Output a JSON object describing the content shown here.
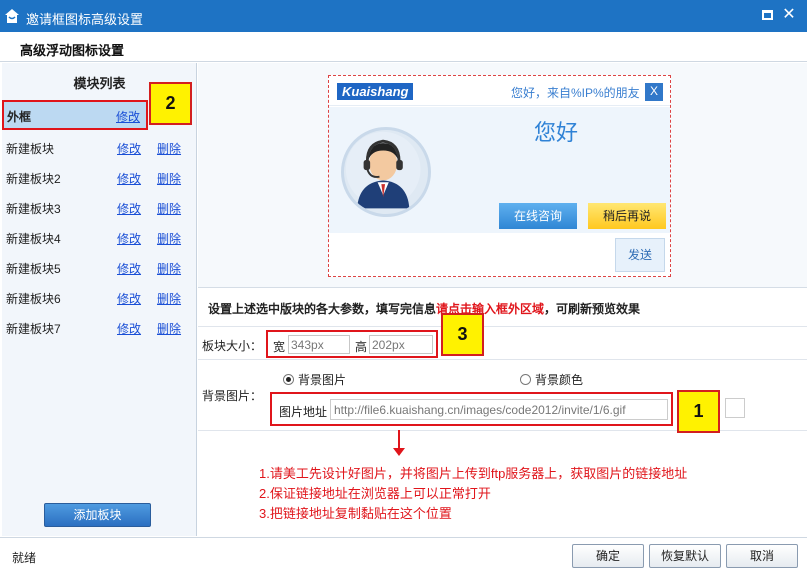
{
  "window": {
    "title": "邀请框图标高级设置",
    "maximize_glyph": "□",
    "close_glyph": "✕"
  },
  "subheader": {
    "title": "高级浮动图标设置"
  },
  "sidebar": {
    "heading": "模块列表",
    "items": [
      {
        "name": "外框",
        "edit": "修改",
        "delete": ""
      },
      {
        "name": "新建板块",
        "edit": "修改",
        "delete": "删除"
      },
      {
        "name": "新建板块2",
        "edit": "修改",
        "delete": "删除"
      },
      {
        "name": "新建板块3",
        "edit": "修改",
        "delete": "删除"
      },
      {
        "name": "新建板块4",
        "edit": "修改",
        "delete": "删除"
      },
      {
        "name": "新建板块5",
        "edit": "修改",
        "delete": "删除"
      },
      {
        "name": "新建板块6",
        "edit": "修改",
        "delete": "删除"
      },
      {
        "name": "新建板块7",
        "edit": "修改",
        "delete": "删除"
      }
    ],
    "add_button": "添加板块"
  },
  "callouts": {
    "c1": "1",
    "c2": "2",
    "c3": "3"
  },
  "preview": {
    "brand": "Kuaishang",
    "greeting": "您好，来自%IP%的朋友",
    "close": "X",
    "hello": "您好",
    "online_btn": "在线咨询",
    "later_btn": "稍后再说",
    "send_btn": "发送"
  },
  "instruction": {
    "part1": "设置上述选中版块的各大参数，填写完信息",
    "part2": "请点击输入框外区域",
    "part3": "，可刷新预览效果"
  },
  "size": {
    "label": "板块大小：",
    "width_label": "宽",
    "width_value": "343px",
    "height_label": "高",
    "height_value": "202px"
  },
  "background": {
    "label": "背景图片：",
    "radio_image": "背景图片",
    "radio_color": "背景颜色",
    "url_label": "图片地址",
    "url_value": "http://file6.kuaishang.cn/images/code2012/invite/1/6.gif"
  },
  "notes": [
    "1.请美工先设计好图片，并将图片上传到ftp服务器上，获取图片的链接地址",
    "2.保证链接地址在浏览器上可以正常打开",
    "3.把链接地址复制黏贴在这个位置"
  ],
  "status": {
    "text": "就绪"
  },
  "buttons": {
    "ok": "确定",
    "reset": "恢复默认",
    "cancel": "取消"
  },
  "colors": {
    "titlebar": "#1e73c4",
    "highlight_red": "#e0151b",
    "callout_yellow": "#fff200",
    "link_blue": "#1a4fd6"
  }
}
